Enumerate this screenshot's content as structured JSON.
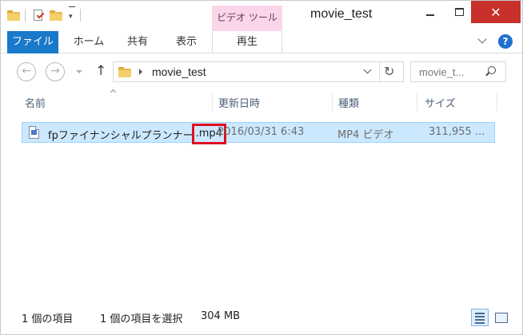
{
  "window": {
    "title": "movie_test",
    "context_tab": "ビデオ ツール",
    "close_glyph": "✕"
  },
  "ribbon": {
    "tabs": [
      {
        "label": "ファイル",
        "active": true
      },
      {
        "label": "ホーム"
      },
      {
        "label": "共有"
      },
      {
        "label": "表示"
      },
      {
        "label": "再生"
      }
    ],
    "help_label": "?"
  },
  "nav": {
    "back_glyph": "←",
    "forward_glyph": "→",
    "up_glyph": "↑",
    "refresh_glyph": "↻",
    "address": "movie_test",
    "search_placeholder": "movie_t..."
  },
  "columns": [
    "名前",
    "更新日時",
    "種類",
    "サイズ"
  ],
  "files": [
    {
      "name_base": "fpファイナンシャルプランナー",
      "name_ext": ".mp4",
      "modified": "2016/03/31 6:43",
      "type": "MP4 ビデオ",
      "size": "311,955 ...",
      "selected": true
    }
  ],
  "status": {
    "item_count": "1 個の項目",
    "selected": "1 個の項目を選択",
    "selected_size": "304 MB"
  },
  "colors": {
    "file_tab_bg": "#1979ca",
    "context_tab_bg": "#f9d6e9",
    "close_button_bg": "#c7302b",
    "selection_bg": "#cce8ff",
    "highlight_border": "#e01020"
  },
  "icons": {
    "qat": [
      "folder-icon",
      "properties-icon",
      "new-folder-icon"
    ],
    "nav": [
      "back-arrow-icon",
      "forward-arrow-icon",
      "up-arrow-icon",
      "refresh-icon",
      "search-icon"
    ],
    "file": "mp4-file-icon"
  }
}
